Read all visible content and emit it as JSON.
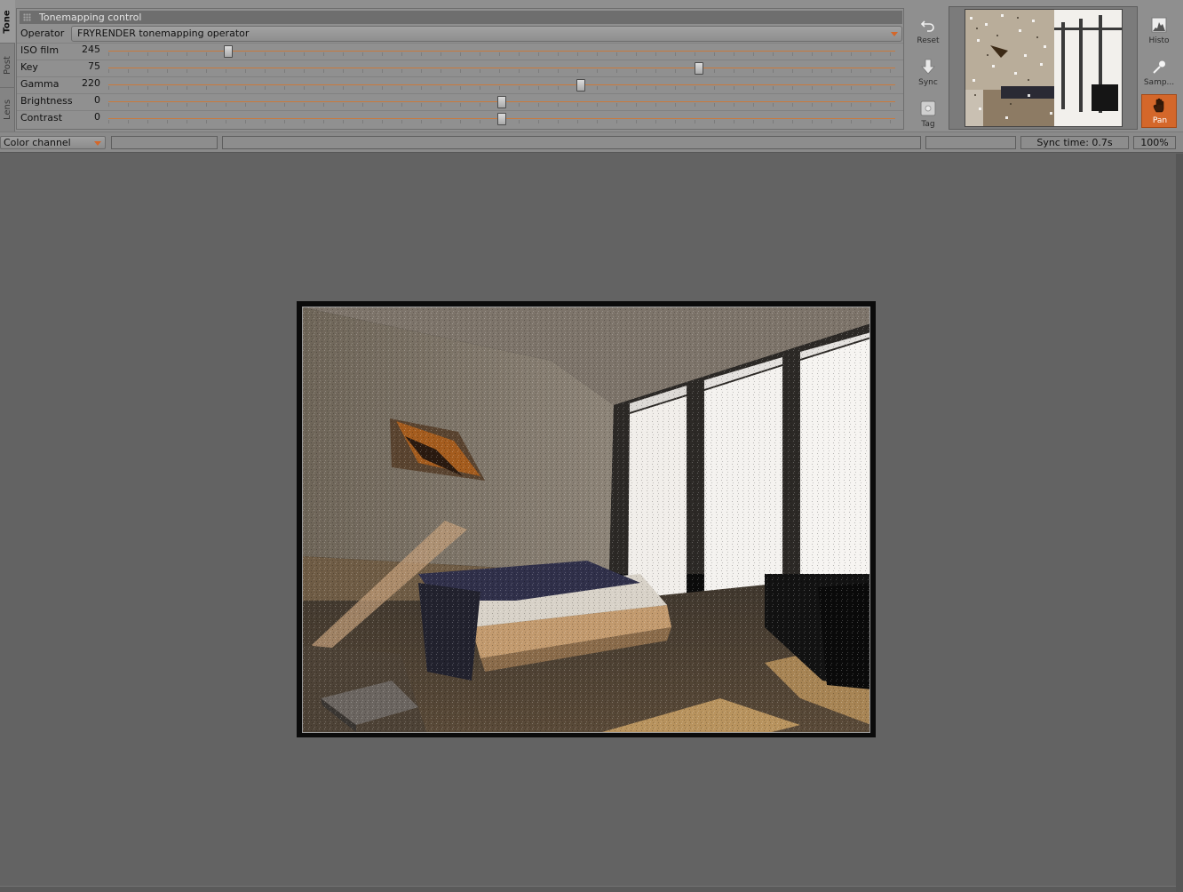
{
  "tabs": [
    "Tone",
    "Post",
    "Lens"
  ],
  "tonemapping": {
    "title": "Tonemapping control",
    "operator_label": "Operator",
    "operator_value": "FRYRENDER tonemapping operator",
    "controls": [
      {
        "label": "ISO film",
        "value": "245",
        "level": 0.152
      },
      {
        "label": "Key",
        "value": "75",
        "level": 0.75
      },
      {
        "label": "Gamma",
        "value": "220",
        "level": 0.6
      },
      {
        "label": "Brightness",
        "value": "0",
        "level": 0.5
      },
      {
        "label": "Contrast",
        "value": "0",
        "level": 0.5
      }
    ]
  },
  "tools": {
    "reset": "Reset",
    "sync": "Sync",
    "tag": "Tag",
    "histo": "Histo",
    "sampler": "Samp...",
    "pan": "Pan"
  },
  "status": {
    "channel": "Color channel",
    "sync_time": "Sync time:  0.7s",
    "zoom": "100%"
  },
  "colors": {
    "accent": "#d4672a",
    "panel": "#8f8f8f",
    "viewport": "#636363"
  }
}
